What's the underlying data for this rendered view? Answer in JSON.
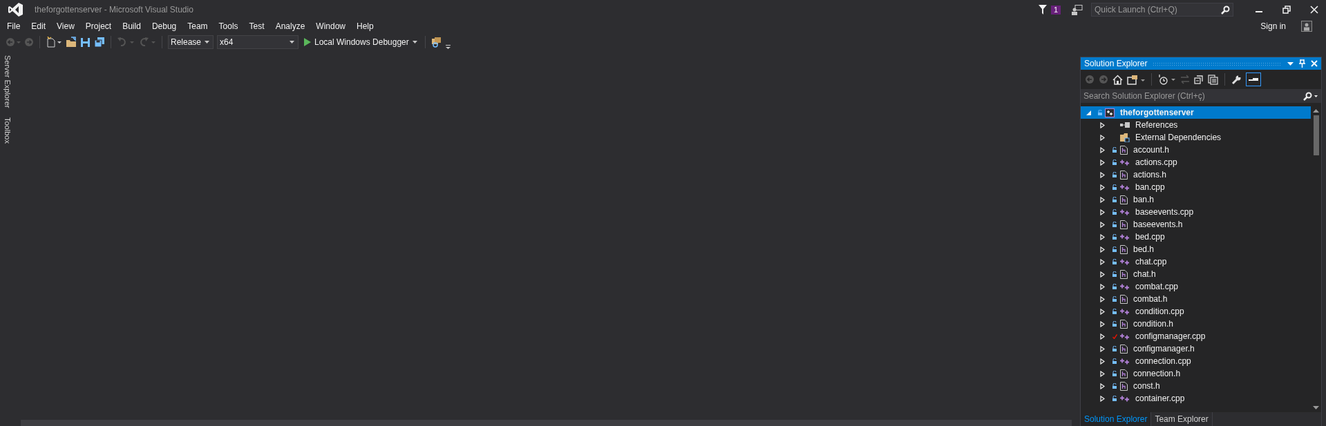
{
  "window": {
    "title": "theforgottenserver - Microsoft Visual Studio"
  },
  "notifications": {
    "count": "1"
  },
  "quick_launch": {
    "placeholder": "Quick Launch (Ctrl+Q)"
  },
  "menu": [
    "File",
    "Edit",
    "View",
    "Project",
    "Build",
    "Debug",
    "Team",
    "Tools",
    "Test",
    "Analyze",
    "Window",
    "Help"
  ],
  "account": {
    "label": "Sign in"
  },
  "toolbar": {
    "configuration": "Release",
    "platform": "x64",
    "debugger": "Local Windows Debugger"
  },
  "side_tabs": [
    "Server Explorer",
    "Toolbox"
  ],
  "solution_explorer": {
    "title": "Solution Explorer",
    "search_placeholder": "Search Solution Explorer (Ctrl+ç)",
    "project": {
      "label": "theforgottenserver",
      "expanded": true,
      "selected": true,
      "children": [
        {
          "label": "References",
          "kind": "references"
        },
        {
          "label": "External Dependencies",
          "kind": "folder"
        },
        {
          "label": "account.h",
          "kind": "header",
          "checked_out": false
        },
        {
          "label": "actions.cpp",
          "kind": "source",
          "checked_out": false
        },
        {
          "label": "actions.h",
          "kind": "header",
          "checked_out": false
        },
        {
          "label": "ban.cpp",
          "kind": "source",
          "checked_out": false
        },
        {
          "label": "ban.h",
          "kind": "header",
          "checked_out": false
        },
        {
          "label": "baseevents.cpp",
          "kind": "source",
          "checked_out": false
        },
        {
          "label": "baseevents.h",
          "kind": "header",
          "checked_out": false
        },
        {
          "label": "bed.cpp",
          "kind": "source",
          "checked_out": false
        },
        {
          "label": "bed.h",
          "kind": "header",
          "checked_out": false
        },
        {
          "label": "chat.cpp",
          "kind": "source",
          "checked_out": false
        },
        {
          "label": "chat.h",
          "kind": "header",
          "checked_out": false
        },
        {
          "label": "combat.cpp",
          "kind": "source",
          "checked_out": false
        },
        {
          "label": "combat.h",
          "kind": "header",
          "checked_out": false
        },
        {
          "label": "condition.cpp",
          "kind": "source",
          "checked_out": false
        },
        {
          "label": "condition.h",
          "kind": "header",
          "checked_out": false
        },
        {
          "label": "configmanager.cpp",
          "kind": "source",
          "checked_out": true
        },
        {
          "label": "configmanager.h",
          "kind": "header",
          "checked_out": false
        },
        {
          "label": "connection.cpp",
          "kind": "source",
          "checked_out": false
        },
        {
          "label": "connection.h",
          "kind": "header",
          "checked_out": false
        },
        {
          "label": "const.h",
          "kind": "header",
          "checked_out": false
        },
        {
          "label": "container.cpp",
          "kind": "source",
          "checked_out": false
        }
      ]
    }
  },
  "bottom_tabs": [
    {
      "label": "Solution Explorer",
      "selected": true
    },
    {
      "label": "Team Explorer",
      "selected": false
    }
  ]
}
